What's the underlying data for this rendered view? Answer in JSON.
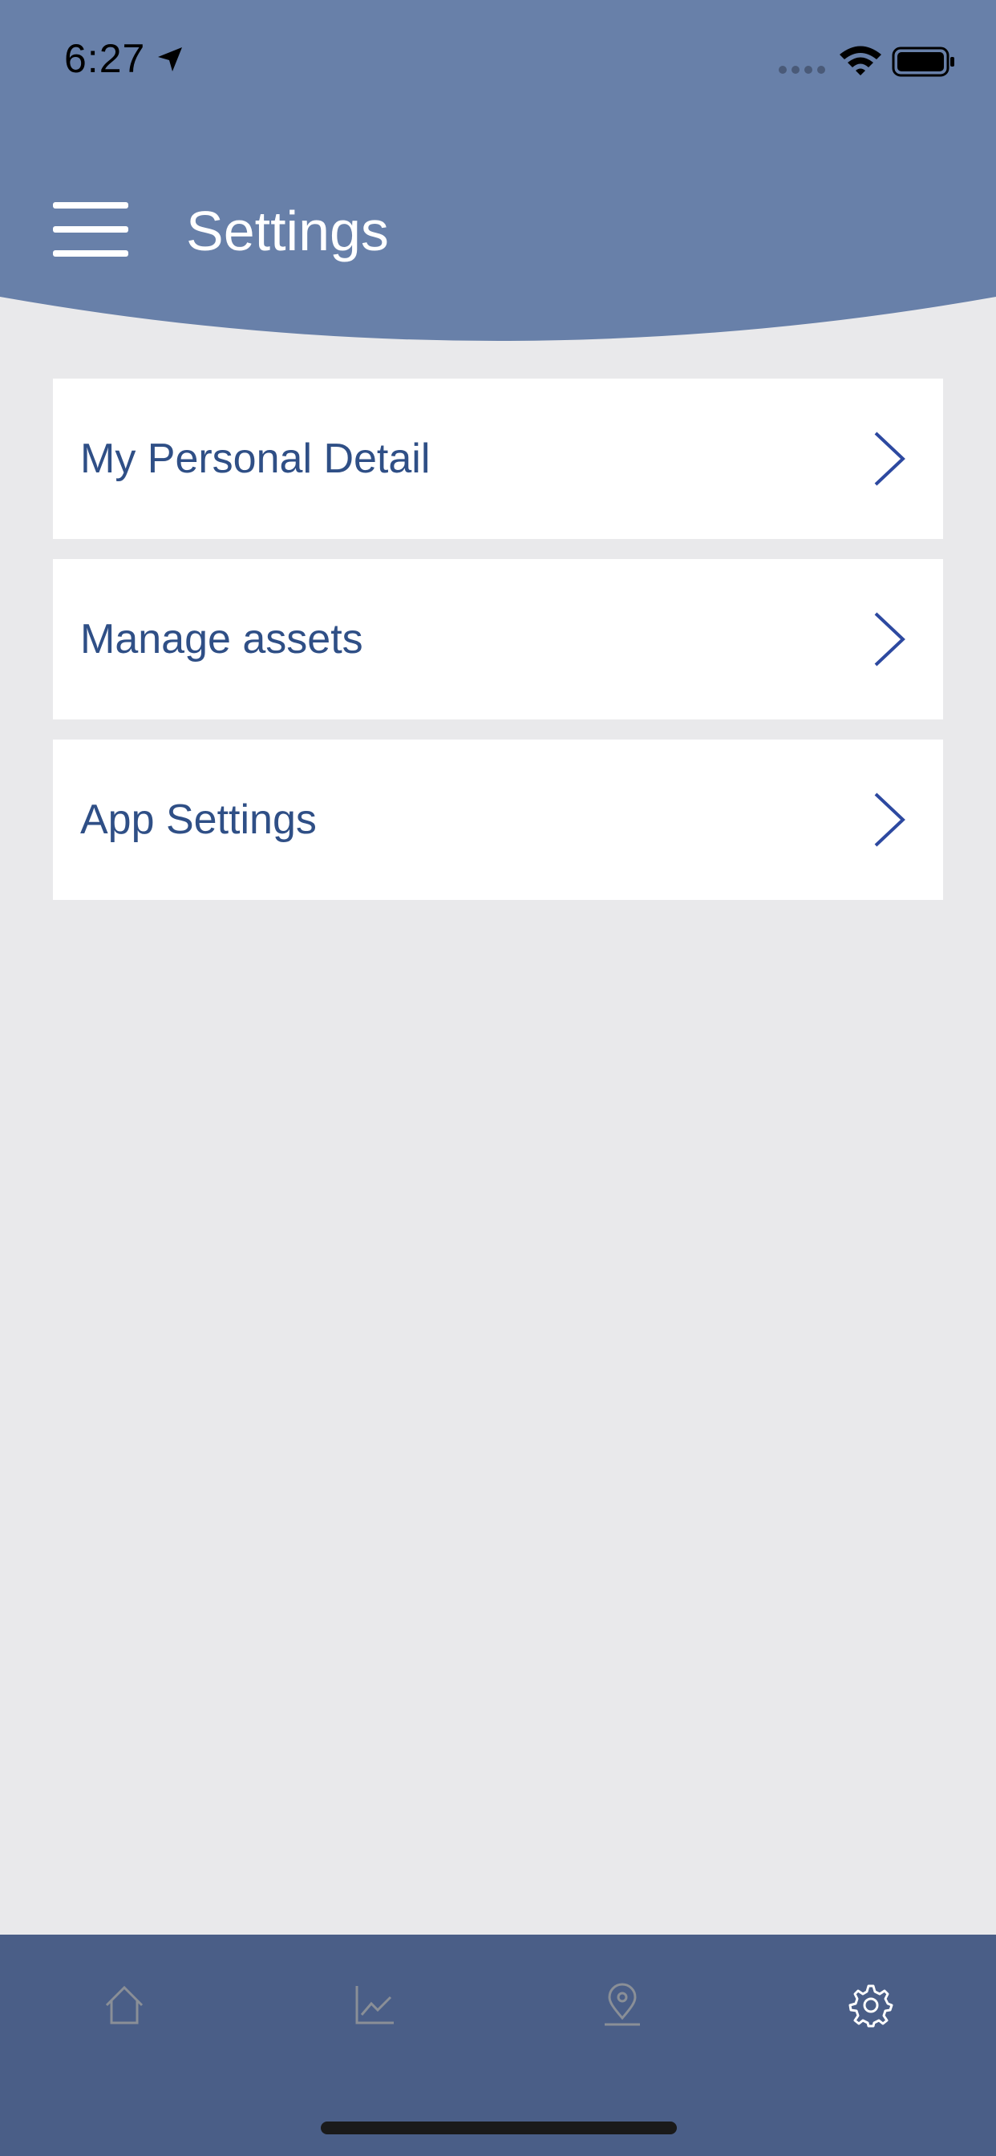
{
  "status_bar": {
    "time": "6:27"
  },
  "header": {
    "title": "Settings"
  },
  "menu_items": [
    {
      "label": "My Personal Detail"
    },
    {
      "label": "Manage assets"
    },
    {
      "label": "App Settings"
    }
  ],
  "tab_bar": {
    "tabs": [
      {
        "icon": "home-icon",
        "active": false
      },
      {
        "icon": "chart-icon",
        "active": false
      },
      {
        "icon": "location-pin-icon",
        "active": false
      },
      {
        "icon": "gear-icon",
        "active": true
      }
    ]
  },
  "colors": {
    "header_bg": "#6880a9",
    "page_bg": "#e9e9eb",
    "item_text": "#2f4f86",
    "chevron": "#2d49a0",
    "tabbar_bg": "#4a5e87",
    "tab_inactive": "#8a8f97",
    "tab_active": "#ffffff"
  }
}
